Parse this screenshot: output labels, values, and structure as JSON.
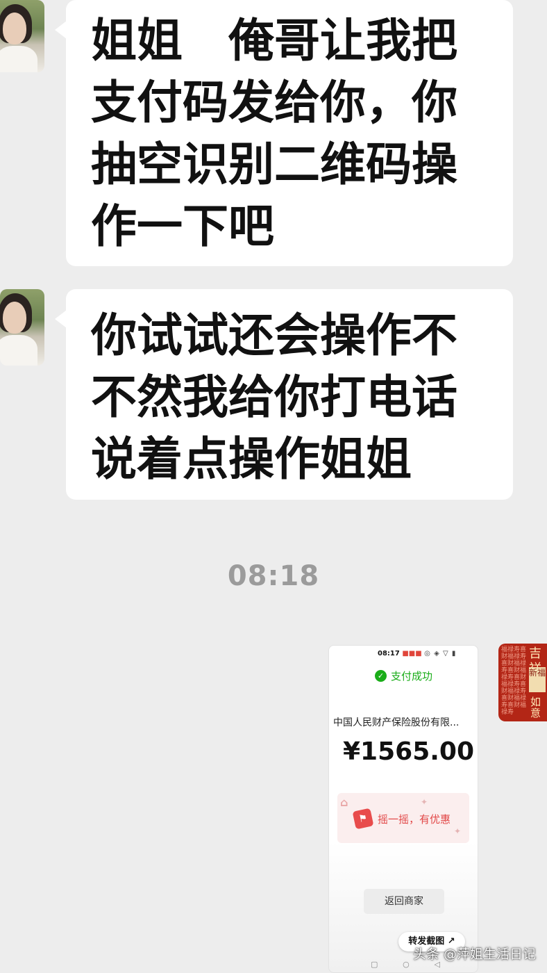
{
  "messages": [
    {
      "text": "姐姐　俺哥让我把支付码发给你，你抽空识别二维码操作一下吧"
    },
    {
      "text": "你试试还会操作不不然我给你打电话说着点操作姐姐"
    }
  ],
  "timestamp": "08:18",
  "screenshot": {
    "status_time": "08:17",
    "success_text": "支付成功",
    "merchant": "中国人民财产保险股份有限...",
    "amount": "¥1565.00",
    "promo_text": "摇一摇，有优惠",
    "back_button": "返回商家",
    "forward_button": "转发截图 ↗"
  },
  "my_avatar": {
    "blessing_top": "吉祥",
    "blessing_mid": "新福",
    "blessing_bottom": "如意"
  },
  "watermark": "头条 @萍姐生活日记"
}
